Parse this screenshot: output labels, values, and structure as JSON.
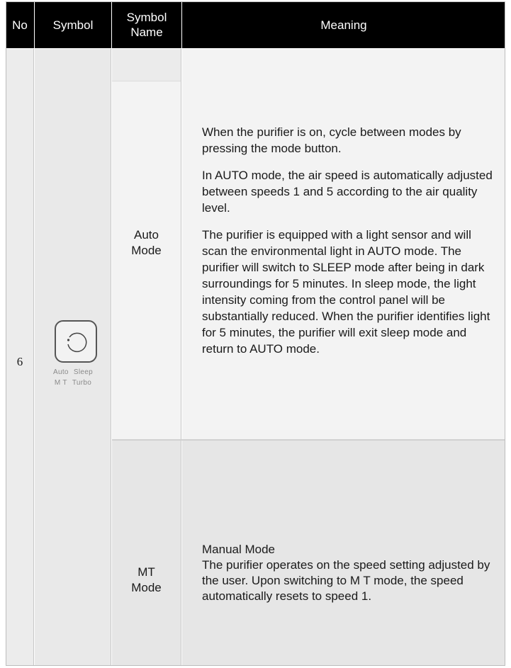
{
  "header": {
    "no": "No",
    "symbol": "Symbol",
    "symbol_name_line1": "Symbol",
    "symbol_name_line2": "Name",
    "meaning": "Meaning"
  },
  "row": {
    "no": "6",
    "symbol_caption_line1": [
      "Auto",
      "Sleep"
    ],
    "symbol_caption_line2": [
      "M T",
      "Turbo"
    ],
    "icon": "circular-cycle-icon",
    "entries": [
      {
        "name_line1": "Auto",
        "name_line2": "Mode",
        "paragraphs": [
          "When the purifier is on, cycle between modes by pressing the mode button.",
          "In AUTO mode, the air speed is automatically adjusted between speeds 1 and 5 according to the air quality level.",
          "The purifier is equipped with a light sensor and will scan the environmental light in AUTO mode. The purifier will switch to SLEEP mode after being in dark surroundings for 5 minutes. In sleep mode, the light intensity coming from the control panel will be substantially reduced. When the purifier identifies light for 5 minutes, the purifier will exit sleep mode and return to AUTO mode."
        ]
      },
      {
        "name_line1": "MT",
        "name_line2": "Mode",
        "paragraphs": [
          "Manual Mode",
          "The purifier operates on the speed setting adjusted by the user. Upon switching to M T mode, the speed automatically resets to speed 1."
        ]
      }
    ]
  },
  "colors": {
    "header_bg": "#000000",
    "header_text": "#ffffff",
    "row1_bg": "#f3f3f3",
    "row2_bg": "#e6e6e6"
  }
}
